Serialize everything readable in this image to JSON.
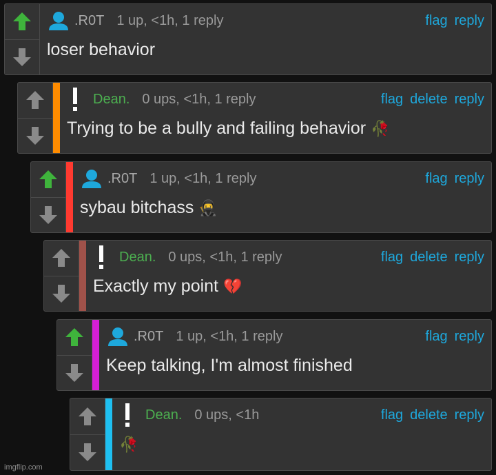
{
  "thread": {
    "actions": {
      "flag": "flag",
      "delete": "delete",
      "reply": "reply"
    },
    "comments": [
      {
        "username": ".R0T",
        "stats": "1 up, <1h, 1 reply",
        "text": "loser behavior",
        "emoji": "",
        "upvoted": true
      },
      {
        "username": "Dean.",
        "stats": "0 ups, <1h, 1 reply",
        "text": "Trying to be a bully and failing behavior",
        "emoji": "🥀",
        "stripe_color": "#ff8c00",
        "upvoted": false
      },
      {
        "username": ".R0T",
        "stats": "1 up, <1h, 1 reply",
        "text": "sybau bitchass",
        "emoji": "🥷",
        "stripe_color": "#ff3a30",
        "upvoted": true
      },
      {
        "username": "Dean.",
        "stats": "0 ups, <1h, 1 reply",
        "text": "Exactly my point",
        "emoji": "💔",
        "stripe_color": "#a0524a",
        "upvoted": false
      },
      {
        "username": ".R0T",
        "stats": "1 up, <1h, 1 reply",
        "text": "Keep talking, I'm almost finished",
        "emoji": "",
        "stripe_color": "#d61fd6",
        "upvoted": true
      },
      {
        "username": "Dean.",
        "stats": "0 ups, <1h",
        "text": "",
        "emoji": "🥀",
        "stripe_color": "#1ebff0",
        "upvoted": false
      }
    ]
  },
  "colors": {
    "upvote_active": "#3fb43c",
    "vote_inactive": "#8a8a8a",
    "link": "#1ea8dc",
    "username_green": "#4caf50",
    "avatar_blue": "#1ea8dc"
  },
  "watermark": "imgflip.com"
}
